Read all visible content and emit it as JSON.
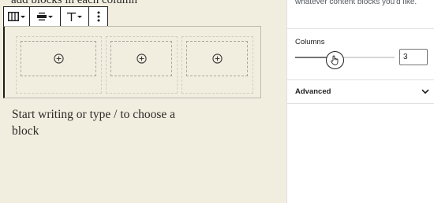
{
  "editor": {
    "top_text_fragment": "add blocks in each column",
    "prompt": "Start writing or type / to choose a block",
    "column_count": 3
  },
  "toolbar": {
    "icons": [
      "columns-icon",
      "align-center-icon",
      "vertical-align-top-icon",
      "more-options-icon"
    ]
  },
  "sidebar": {
    "description": "whatever content blocks you'd like.",
    "columns_label": "Columns",
    "columns_value": "3",
    "columns_range_value": 3,
    "advanced_label": "Advanced"
  },
  "colors": {
    "canvas_bg": "#f2eedf",
    "sidebar_bg": "#ffffff",
    "text": "#1e1e1e"
  }
}
